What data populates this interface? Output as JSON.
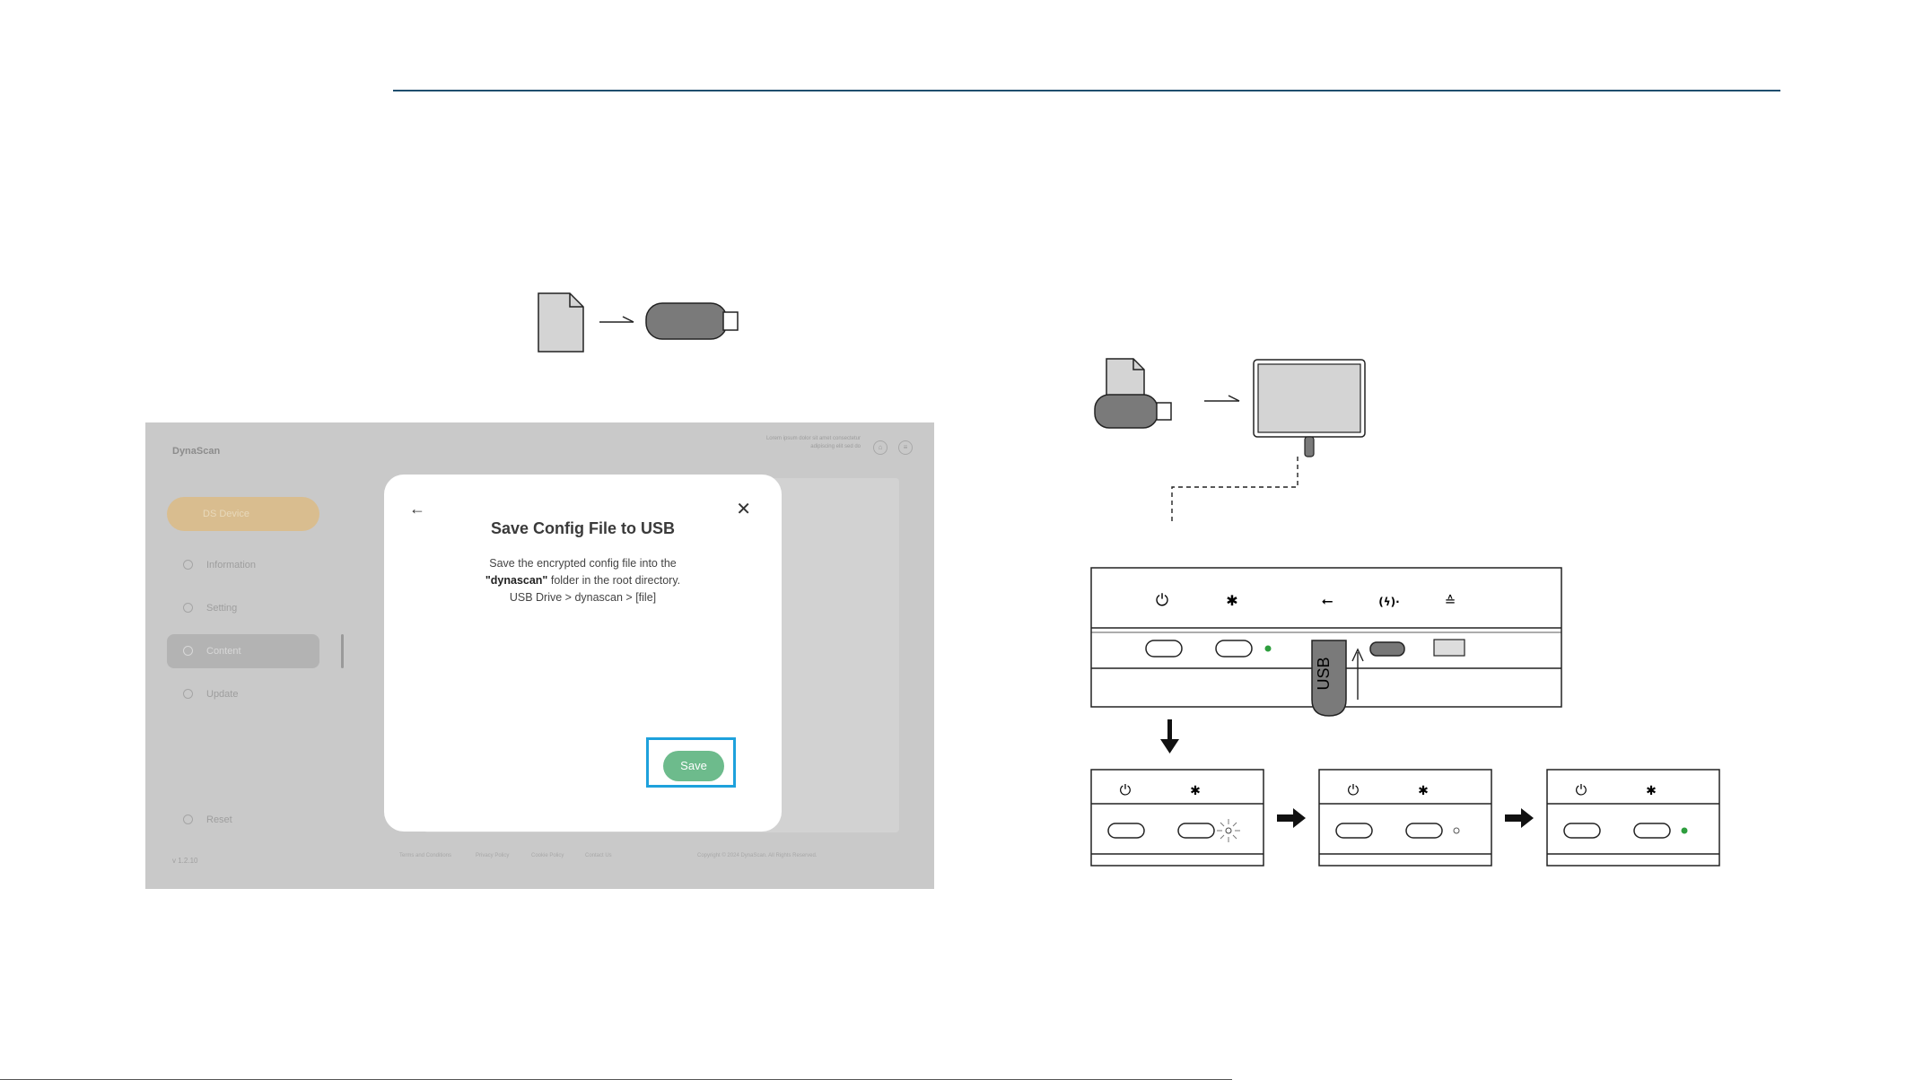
{
  "modal": {
    "title": "Save Config File to USB",
    "desc_line1": "Save the encrypted config file into the",
    "desc_folder": "\"dynascan\"",
    "desc_line2_rest": " folder in the root directory.",
    "desc_line3": "USB Drive > dynascan > [file]",
    "back_icon": "arrow-left-icon",
    "close_icon": "close-icon",
    "save_label": "Save",
    "highlight_color": "#1ea1dc",
    "save_color": "#6dbb8c"
  },
  "app": {
    "logo": "DynaScan",
    "header_info": "Lorem ipsum dolor sit amet consectetur adipiscing elit sed do",
    "nav_pill_label": "DS Device",
    "nav": [
      {
        "label": "Information",
        "icon": "info-icon"
      },
      {
        "label": "Setting",
        "icon": "gear-icon"
      },
      {
        "label": "Content",
        "icon": "content-icon"
      },
      {
        "label": "Update",
        "icon": "update-icon"
      },
      {
        "label": "Reset",
        "icon": "reset-icon"
      }
    ],
    "version": "v 1.2.10",
    "footer_links": [
      "Terms and Conditions",
      "Privacy Policy",
      "Cookie Policy",
      "Contact Us"
    ],
    "copyright": "Copyright © 2024 DynaScan. All Rights Reserved."
  },
  "device": {
    "usb_label": "USB",
    "port_icons": [
      "power-icon",
      "bluetooth-icon",
      "usb-icon",
      "usb-c-charge-icon",
      "ethernet-icon"
    ],
    "led_colors": {
      "green": "#2e9e3e"
    }
  }
}
